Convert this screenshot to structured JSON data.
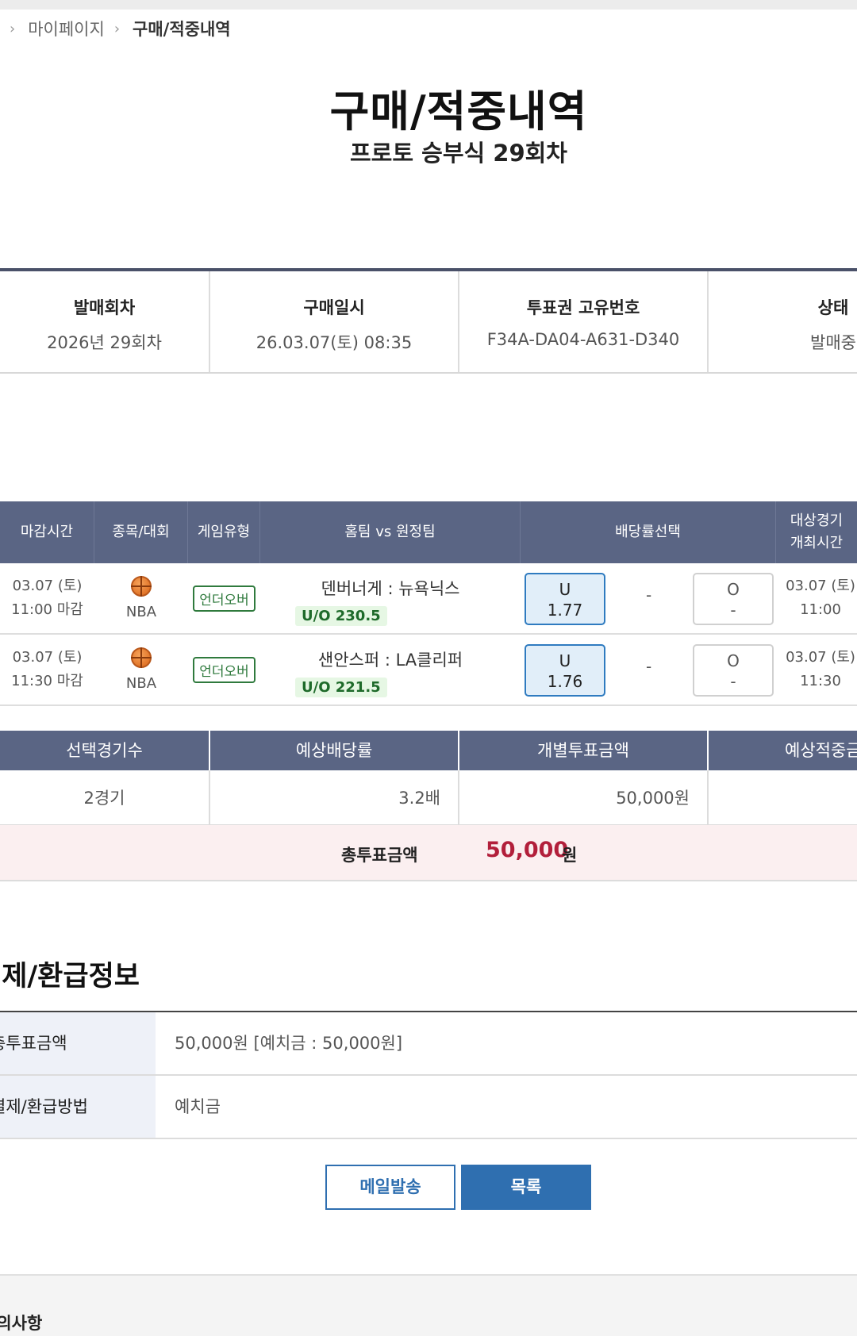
{
  "breadcrumb": {
    "items": [
      "마이페이지",
      "구매/적중내역"
    ]
  },
  "page": {
    "title": "구매/적중내역",
    "subtitle": "프로토 승부식 29회차"
  },
  "info": {
    "columns": [
      {
        "label": "발매회차",
        "value": "2026년 29회차"
      },
      {
        "label": "구매일시",
        "value": "26.03.07(토) 08:35"
      },
      {
        "label": "투표권 고유번호",
        "value": "F34A-DA04-A631-D340"
      },
      {
        "label": "상태",
        "value": "발매중"
      }
    ]
  },
  "games": {
    "headers": {
      "deadline": "마감시간",
      "sport": "종목/대회",
      "game_type": "게임유형",
      "teams": "홈팀 vs 원정팀",
      "odds": "배당률선택",
      "target_line1": "대상경기",
      "target_line2": "개최시간"
    },
    "rows": [
      {
        "deadline_date": "03.07 (토)",
        "deadline_time": "11:00 마감",
        "sport_icon": "basketball-icon",
        "league": "NBA",
        "game_type": "언더오버",
        "match": "덴버너게 : 뉴욕닉스",
        "line": "U/O 230.5",
        "under_label": "U",
        "under_odds": "1.77",
        "middle": "-",
        "over_label": "O",
        "over_odds": "-",
        "target_date": "03.07 (토)",
        "target_time": "11:00"
      },
      {
        "deadline_date": "03.07 (토)",
        "deadline_time": "11:30 마감",
        "sport_icon": "basketball-icon",
        "league": "NBA",
        "game_type": "언더오버",
        "match": "샌안스퍼 : LA클리퍼",
        "line": "U/O 221.5",
        "under_label": "U",
        "under_odds": "1.76",
        "middle": "-",
        "over_label": "O",
        "over_odds": "-",
        "target_date": "03.07 (토)",
        "target_time": "11:30"
      }
    ]
  },
  "summary": {
    "headers": [
      "선택경기수",
      "예상배당률",
      "개별투표금액",
      "예상적중금"
    ],
    "values": [
      "2경기",
      "3.2배",
      "50,000원",
      ""
    ],
    "total_label": "총투표금액",
    "total_value": "50,000",
    "total_unit": "원"
  },
  "payment": {
    "title": "결제/환급정보",
    "rows": [
      {
        "label": "총투표금액",
        "value": "50,000원 [예치금 : 50,000원]"
      },
      {
        "label": "결제/환급방법",
        "value": "예치금"
      }
    ]
  },
  "buttons": {
    "mail": "메일발송",
    "list": "목록"
  },
  "notice": {
    "title": "유의사항"
  },
  "colors": {
    "header_bg": "#5a6584",
    "primary": "#2f6fb0",
    "total_amount": "#b21f3b",
    "badge_green": "#2f7a3d"
  }
}
